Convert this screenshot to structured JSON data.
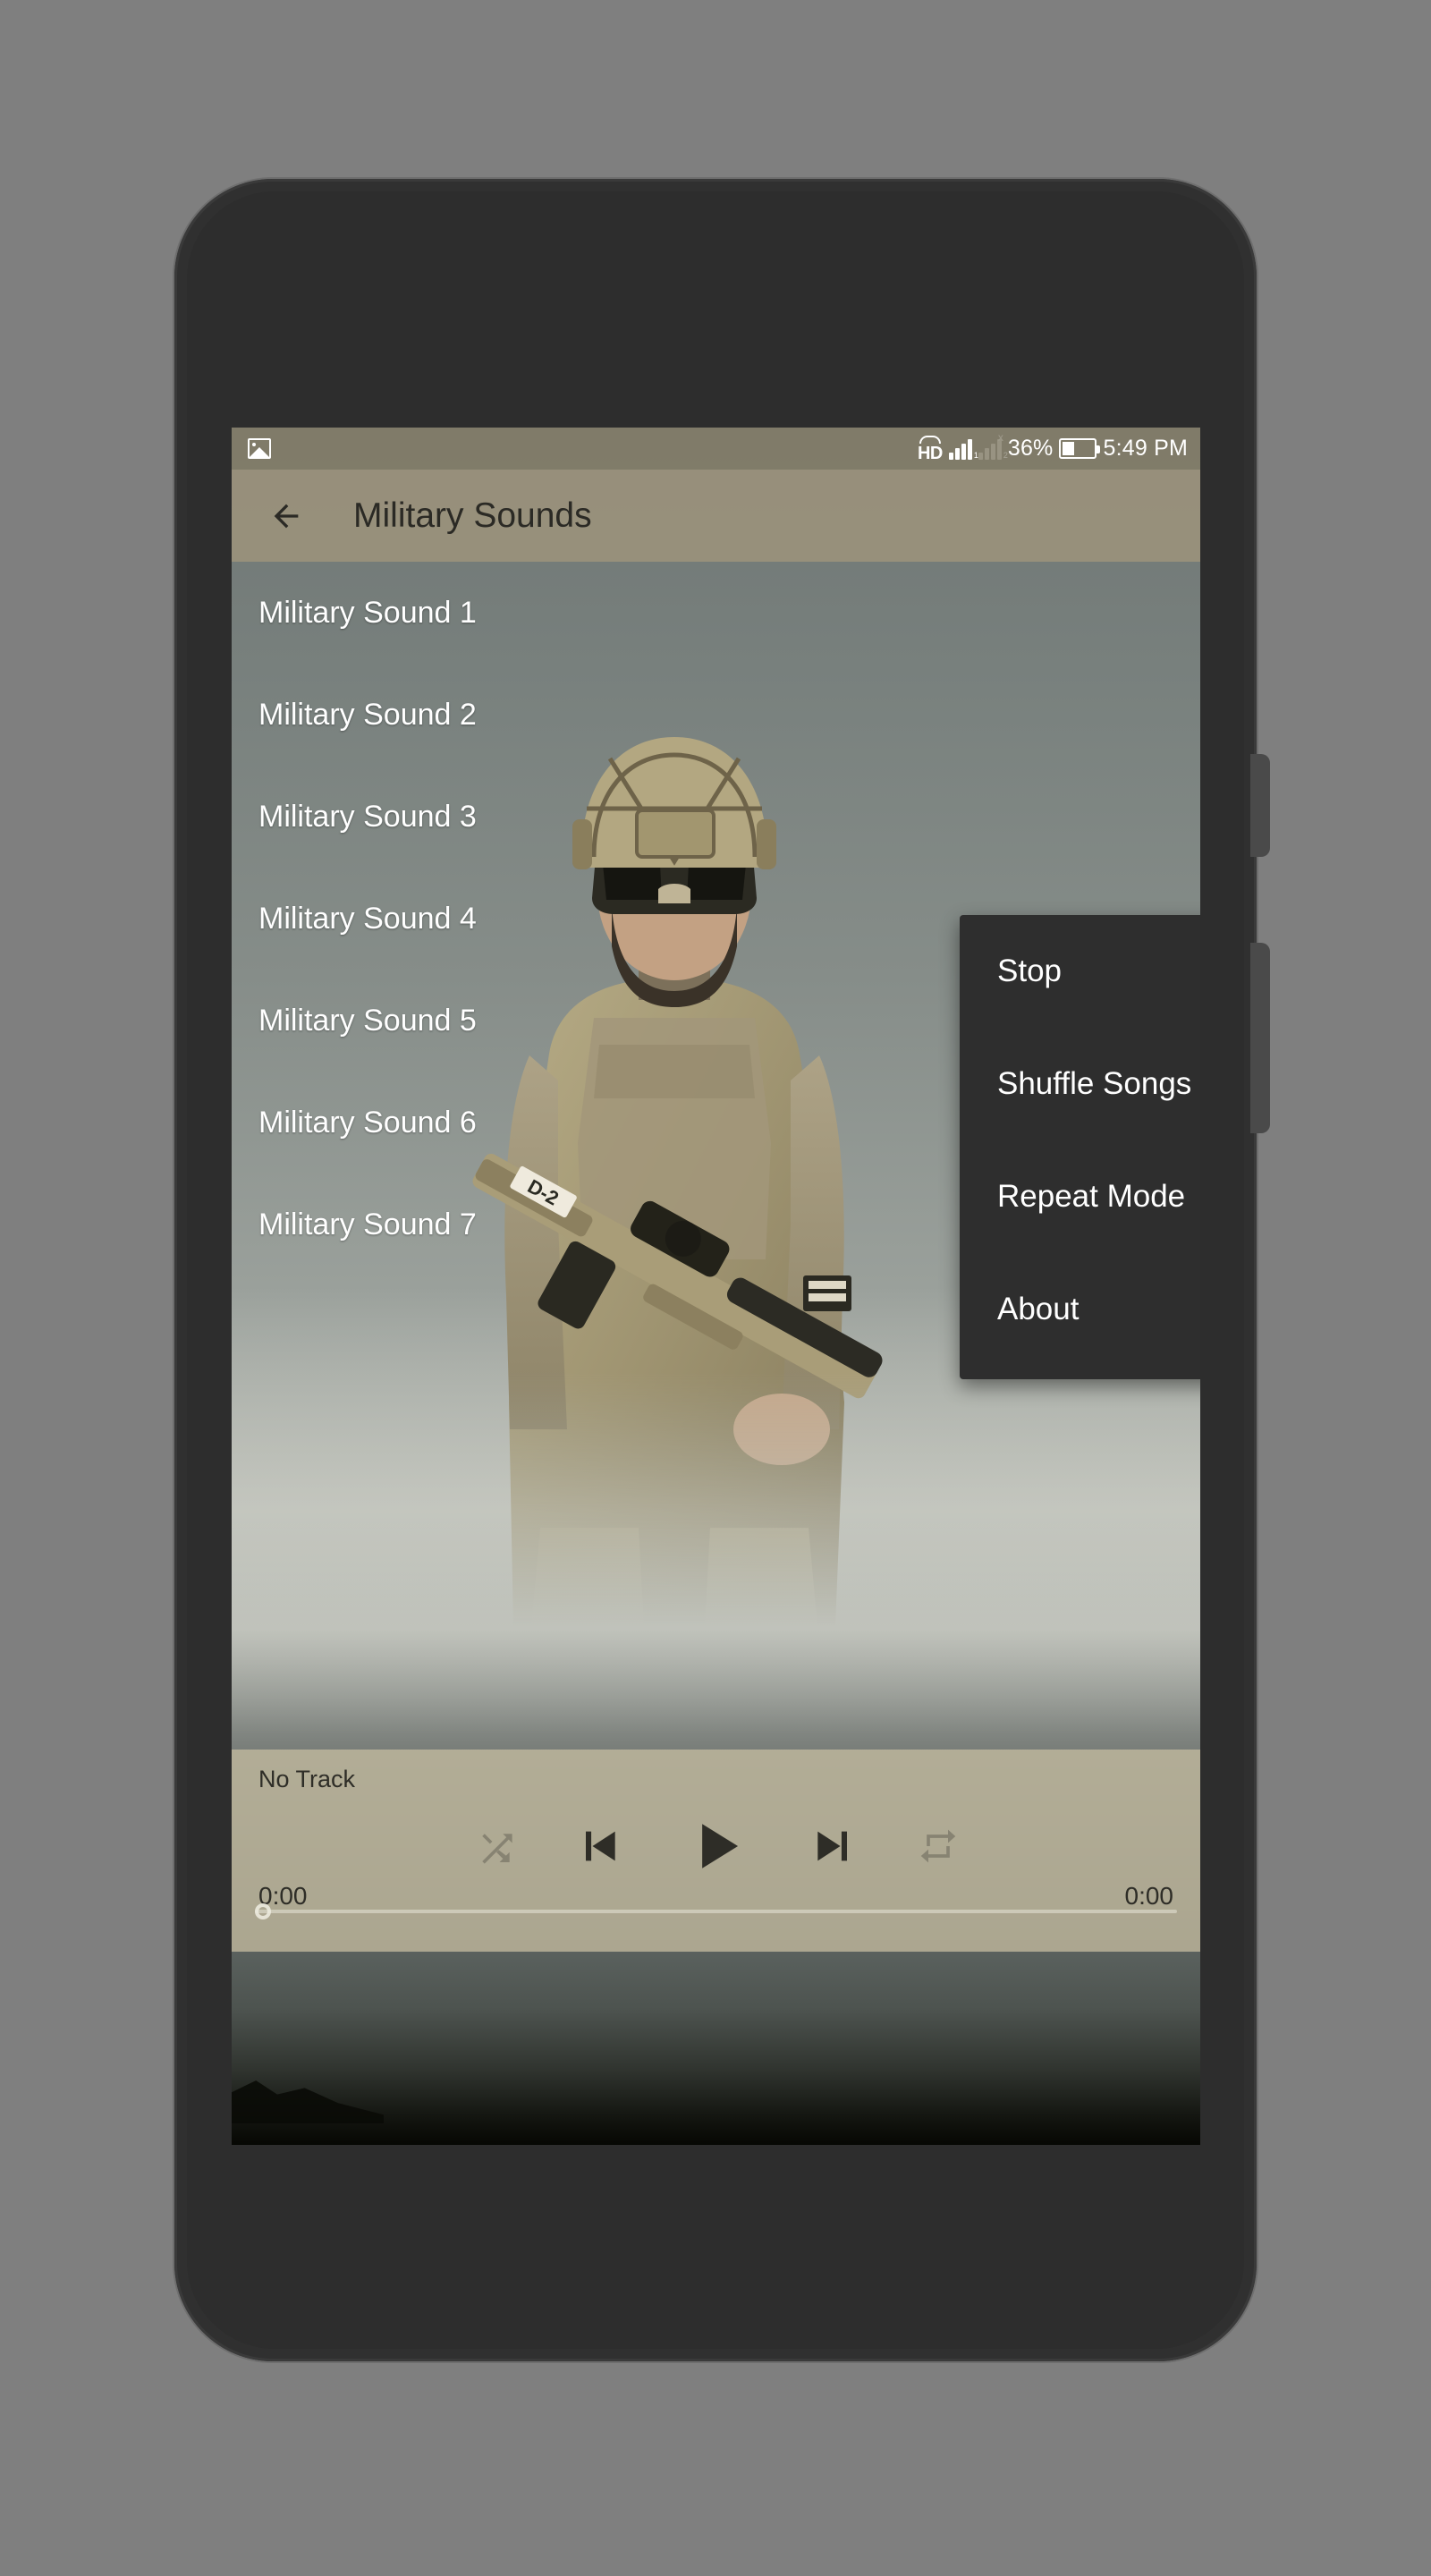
{
  "status_bar": {
    "left_icon": "image-icon",
    "volte_label": "HD",
    "signal1_label": "1",
    "signal2_label": "2",
    "signal2_state": "x",
    "battery_percent": "36%",
    "time": "5:49 PM"
  },
  "app_bar": {
    "back_icon": "arrow-left-icon",
    "title": "Military Sounds"
  },
  "sound_list": {
    "items": [
      {
        "label": "Military Sound 1"
      },
      {
        "label": "Military Sound 2"
      },
      {
        "label": "Military Sound 3"
      },
      {
        "label": "Military Sound 4"
      },
      {
        "label": "Military Sound 5"
      },
      {
        "label": "Military Sound 6"
      },
      {
        "label": "Military Sound 7"
      }
    ]
  },
  "player": {
    "track_name": "No Track",
    "elapsed_time": "0:00",
    "total_time": "0:00",
    "shuffle_icon": "shuffle-icon",
    "previous_icon": "skip-previous-icon",
    "play_icon": "play-icon",
    "next_icon": "skip-next-icon",
    "repeat_icon": "repeat-icon",
    "seek_position_percent": 0
  },
  "overflow_menu": {
    "items": [
      {
        "label": "Stop",
        "has_submenu": false
      },
      {
        "label": "Shuffle Songs",
        "has_submenu": true
      },
      {
        "label": "Repeat Mode",
        "has_submenu": true
      },
      {
        "label": "About",
        "has_submenu": false
      }
    ]
  },
  "theme": {
    "appbar_color": "#9a917c",
    "statusbar_color": "#847d67",
    "menu_bg": "#2e2e2e",
    "player_bg": "#bbb49b",
    "text_light": "#ffffff",
    "text_dark": "#2b2a25",
    "device_body": "#303030",
    "page_bg": "#7f7f7f"
  }
}
